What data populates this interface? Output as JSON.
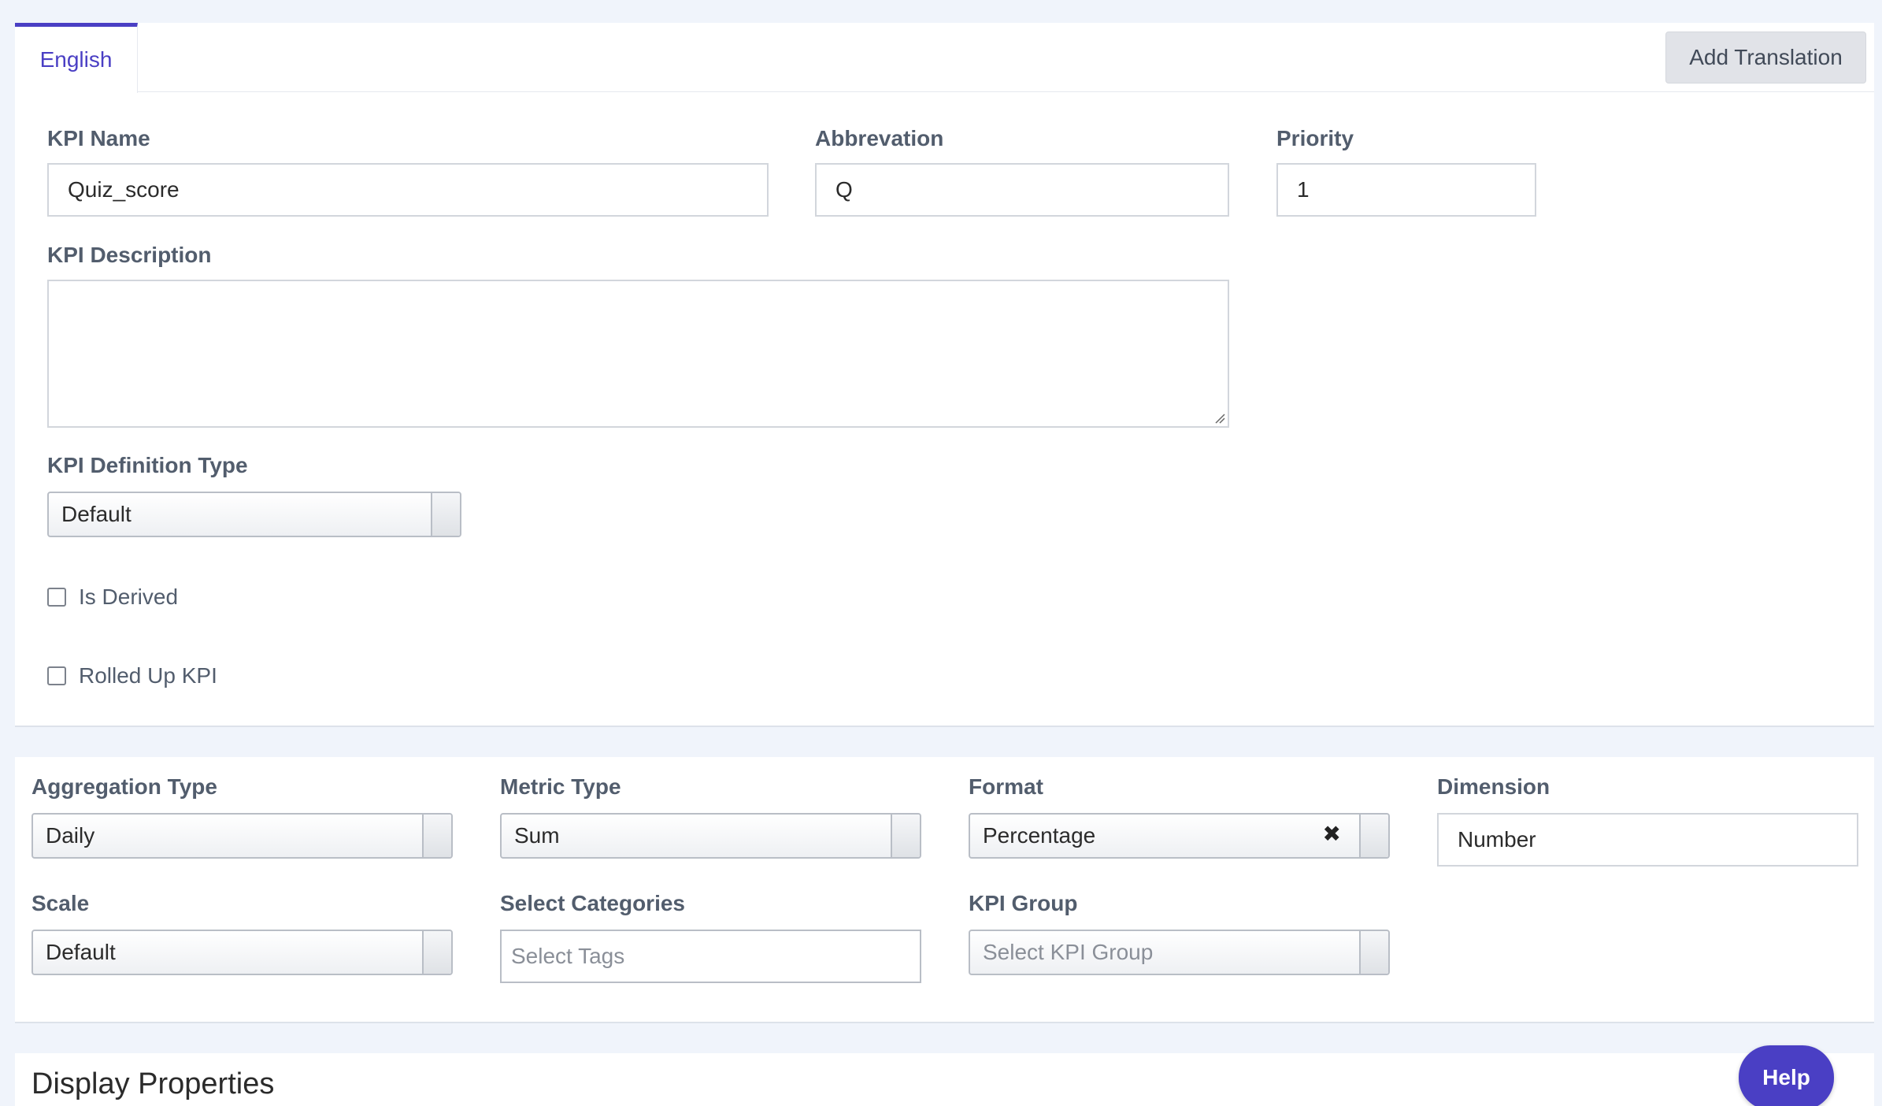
{
  "tabs": {
    "active": "English",
    "add_translation": "Add Translation"
  },
  "kpi_form": {
    "kpi_name": {
      "label": "KPI Name",
      "value": "Quiz_score"
    },
    "abbreviation": {
      "label": "Abbrevation",
      "value": "Q"
    },
    "priority": {
      "label": "Priority",
      "value": "1"
    },
    "description": {
      "label": "KPI Description",
      "value": ""
    },
    "definition_type": {
      "label": "KPI Definition Type",
      "value": "Default"
    },
    "is_derived": {
      "label": "Is Derived",
      "checked": false
    },
    "rolled_up": {
      "label": "Rolled Up KPI",
      "checked": false
    }
  },
  "metrics": {
    "aggregation_type": {
      "label": "Aggregation Type",
      "value": "Daily"
    },
    "metric_type": {
      "label": "Metric Type",
      "value": "Sum"
    },
    "format": {
      "label": "Format",
      "value": "Percentage"
    },
    "dimension": {
      "label": "Dimension",
      "value": "Number"
    },
    "scale": {
      "label": "Scale",
      "value": "Default"
    },
    "categories": {
      "label": "Select Categories",
      "placeholder": "Select Tags"
    },
    "kpi_group": {
      "label": "KPI Group",
      "placeholder": "Select KPI Group"
    }
  },
  "display_properties": {
    "title": "Display Properties"
  },
  "help": {
    "label": "Help"
  },
  "colors": {
    "accent": "#4a3fc4",
    "background": "#f0f4fb",
    "label": "#525d6d"
  }
}
